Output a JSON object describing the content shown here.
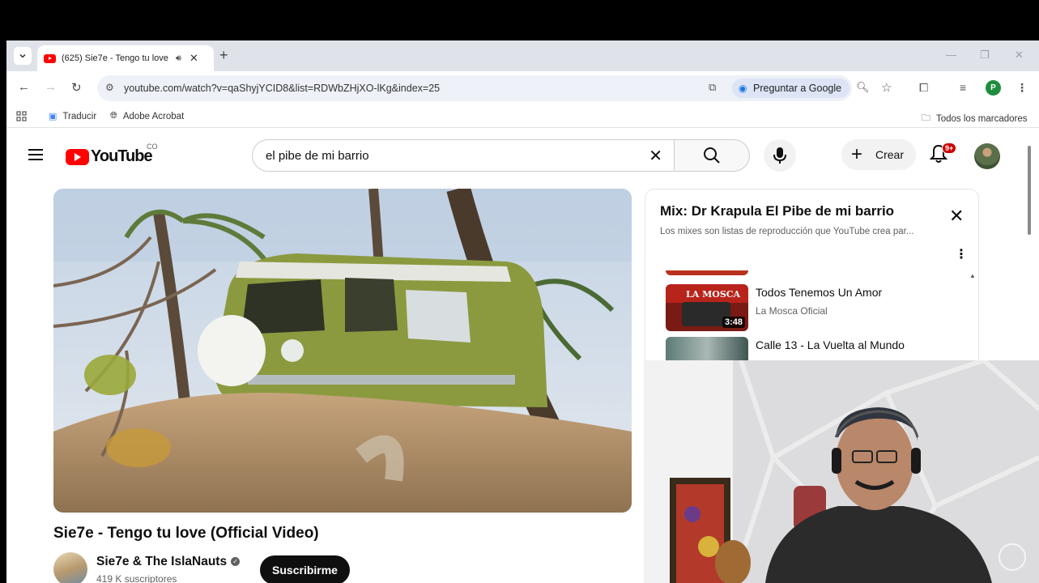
{
  "browser": {
    "tab": {
      "title": "(625) Sie7e - Tengo tu love"
    },
    "new_tab_label": "+",
    "address": {
      "url": "youtube.com/watch?v=qaShyjYCID8&list=RDWbZHjXO-lKg&index=25",
      "google_lens_label": "Preguntar a Google"
    },
    "profile_initial": "P",
    "bookmarks": [
      {
        "label": "Traducir"
      },
      {
        "label": "Adobe Acrobat"
      }
    ],
    "all_bookmarks_label": "Todos los marcadores"
  },
  "youtube": {
    "logo_text": "YouTube",
    "country_code": "CO",
    "search": {
      "query": "el pibe de mi barrio"
    },
    "create_label": "Crear",
    "notifications_badge": "9+",
    "video": {
      "title": "Sie7e - Tengo tu love (Official Video)",
      "channel": "Sie7e & The IslaNauts",
      "subscribers": "419 K suscriptores",
      "subscribe_label": "Suscribirme"
    },
    "playlist": {
      "title": "Mix: Dr Krapula El Pibe de mi barrio",
      "subtitle": "Los mixes son listas de reproducción que YouTube crea par...",
      "items": [
        {
          "title": "Todos Tenemos Un Amor",
          "channel": "La Mosca Oficial",
          "duration": "3:48",
          "thumb_caption": "LA MOSCA"
        },
        {
          "title": "Calle 13 - La Vuelta al Mundo",
          "channel": ""
        }
      ]
    }
  },
  "colors": {
    "youtube_red": "#ff0000",
    "badge_red": "#cc0000",
    "subscribe_bg": "#0f0f0f"
  }
}
